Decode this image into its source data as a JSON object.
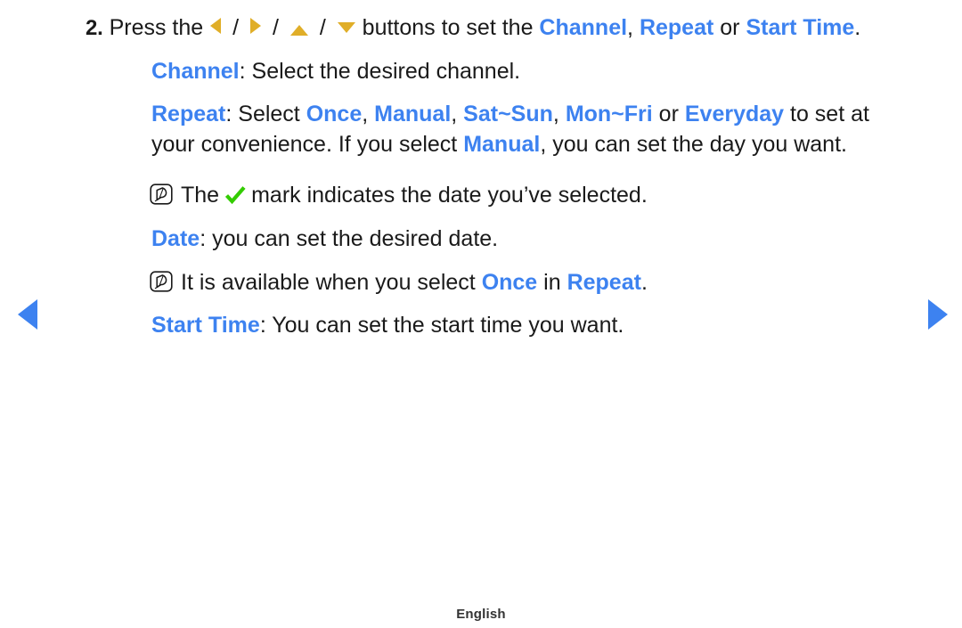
{
  "colors": {
    "accent_blue": "#3d82f0",
    "amber": "#e0ae28",
    "check_green": "#33cc00",
    "text": "#1a1a1a",
    "background": "#ffffff"
  },
  "nav": {
    "prev_label": "Previous page",
    "next_label": "Next page"
  },
  "step": {
    "number": "2.",
    "press_the": "Press the",
    "buttons_to_set_the": "buttons to set the",
    "kw_channel": "Channel",
    "comma": ",",
    "kw_repeat": "Repeat",
    "or": "or",
    "kw_start_time": "Start Time",
    "period": ".",
    "direction_icons": [
      "arrow-left-icon",
      "arrow-right-icon",
      "arrow-up-icon",
      "arrow-down-icon"
    ],
    "separator": "/"
  },
  "channel_line": {
    "keyword": "Channel",
    "rest": ": Select the desired channel."
  },
  "repeat_line": {
    "keyword": "Repeat",
    "select": ": Select ",
    "opt_once": "Once",
    "sep1": ", ",
    "opt_manual": "Manual",
    "sep2": ", ",
    "opt_sat_sun": "Sat~Sun",
    "sep3": ", ",
    "opt_mon_fri": "Mon~Fri",
    "or": " or ",
    "opt_everyday": "Everyday",
    "tail": " to set at",
    "line2_pre": "your convenience. If you select ",
    "line2_kw": "Manual",
    "line2_post": ", you can set the day you want."
  },
  "note_check": {
    "icon": "note-icon",
    "pre": "The",
    "check_icon": "check-mark-icon",
    "post": "mark indicates the date you’ve selected."
  },
  "date_line": {
    "keyword": "Date",
    "rest": ": you can set the desired date."
  },
  "note_once": {
    "icon": "note-icon",
    "pre": "It is available when you select ",
    "kw_once": "Once",
    "mid": " in ",
    "kw_repeat": "Repeat",
    "post": "."
  },
  "start_time_line": {
    "keyword": "Start Time",
    "rest": ": You can set the start time you want."
  },
  "footer": {
    "language": "English"
  }
}
